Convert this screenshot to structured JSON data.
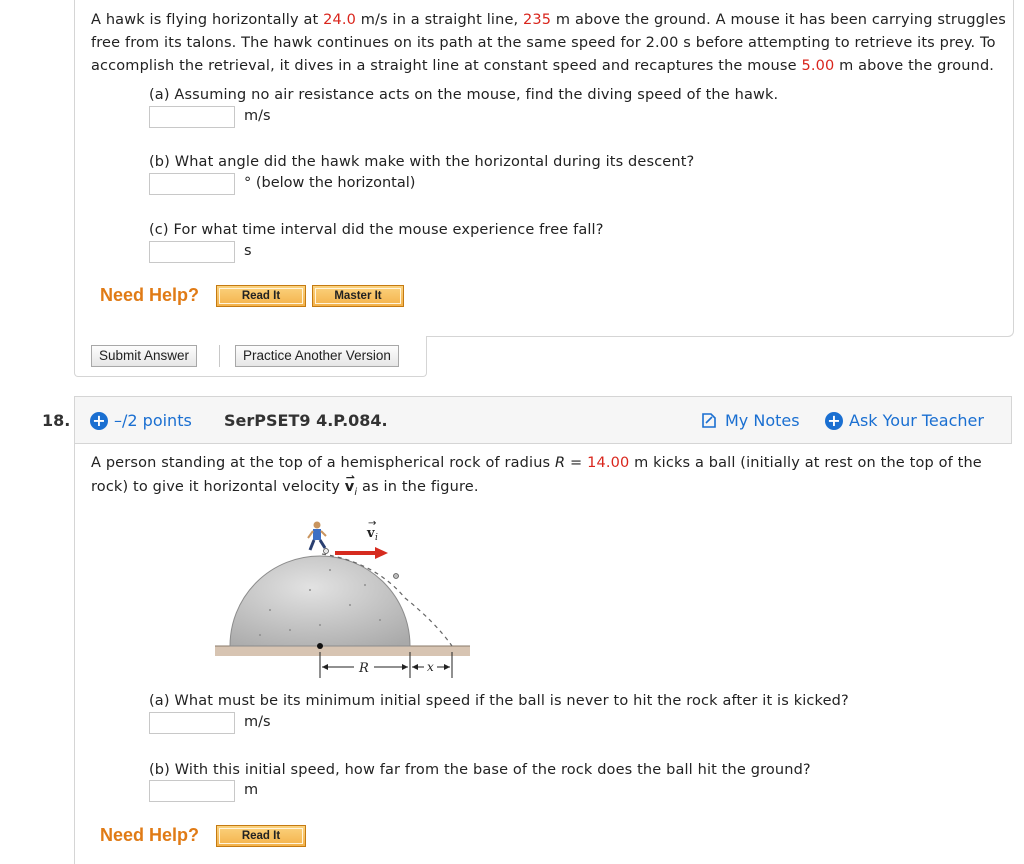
{
  "q17": {
    "problem": {
      "p1": "A hawk is flying horizontally at ",
      "speed": "24.0",
      "p2": " m/s in a straight line, ",
      "height": "235",
      "p3": " m above the ground. A mouse it has been carrying struggles",
      "line2": "free from its talons. The hawk continues on its path at the same speed for 2.00 s before attempting to retrieve its prey. To",
      "line3a": "accomplish the retrieval, it dives in a straight line at constant speed and recaptures the mouse ",
      "recapture": "5.00",
      "line3b": " m above the ground."
    },
    "parts": [
      {
        "question": "(a) Assuming no air resistance acts on the mouse, find the diving speed of the hawk.",
        "unit": "m/s",
        "value": ""
      },
      {
        "question": "(b) What angle did the hawk make with the horizontal during its descent?",
        "unit": "° (below the horizontal)",
        "value": ""
      },
      {
        "question": "(c) For what time interval did the mouse experience free fall?",
        "unit": "s",
        "value": ""
      }
    ],
    "need_help": "Need Help?",
    "read_it": "Read It",
    "master_it": "Master It",
    "submit": "Submit Answer",
    "practice": "Practice Another Version"
  },
  "q18": {
    "number": "18.",
    "points": "–/2 points",
    "code": "SerPSET9 4.P.084.",
    "my_notes": "My Notes",
    "ask_teacher": "Ask Your Teacher",
    "problem": {
      "p1": "A person standing at the top of a hemispherical rock of radius ",
      "r_sym": "R",
      "eq": " = ",
      "radius": "14.00",
      "p2": " m  kicks a ball (initially at rest on the top of the",
      "line2a": "rock) to give it horizontal velocity ",
      "vsym": "v",
      "vsub": "i",
      "line2b": " as in the figure."
    },
    "figure": {
      "label_vi": "v",
      "label_vi_sub": "i",
      "label_R": "R",
      "label_x": "x"
    },
    "parts": [
      {
        "question": "(a) What must be its minimum initial speed if the ball is never to hit the rock after it is kicked?",
        "unit": "m/s",
        "value": ""
      },
      {
        "question": "(b) With this initial speed, how far from the base of the rock does the ball hit the ground?",
        "unit": "m",
        "value": ""
      }
    ],
    "need_help": "Need Help?",
    "read_it": "Read It"
  }
}
